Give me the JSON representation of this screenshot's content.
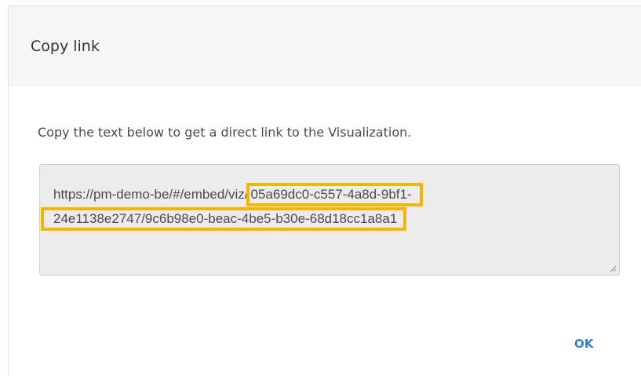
{
  "dialog": {
    "title": "Copy link",
    "message": "Copy the text below to get a direct link to the Visualization.",
    "link": {
      "prefix": "https://pm-demo-be/#/embed/viz/",
      "highlight_part1": "05a69dc0-c557-4a8d-9bf1-",
      "highlight_part2": "24e1138e2747/9c6b98e0-beac-4be5-b30e-68d18cc1a8a1"
    },
    "ok_label": "OK"
  },
  "colors": {
    "highlight_outline": "#f5b400",
    "ok_button": "#2f7fd2",
    "header_background": "#f7f7f8",
    "link_box_background": "#ececec"
  },
  "icons": {
    "resize": "resize-grip-icon"
  }
}
